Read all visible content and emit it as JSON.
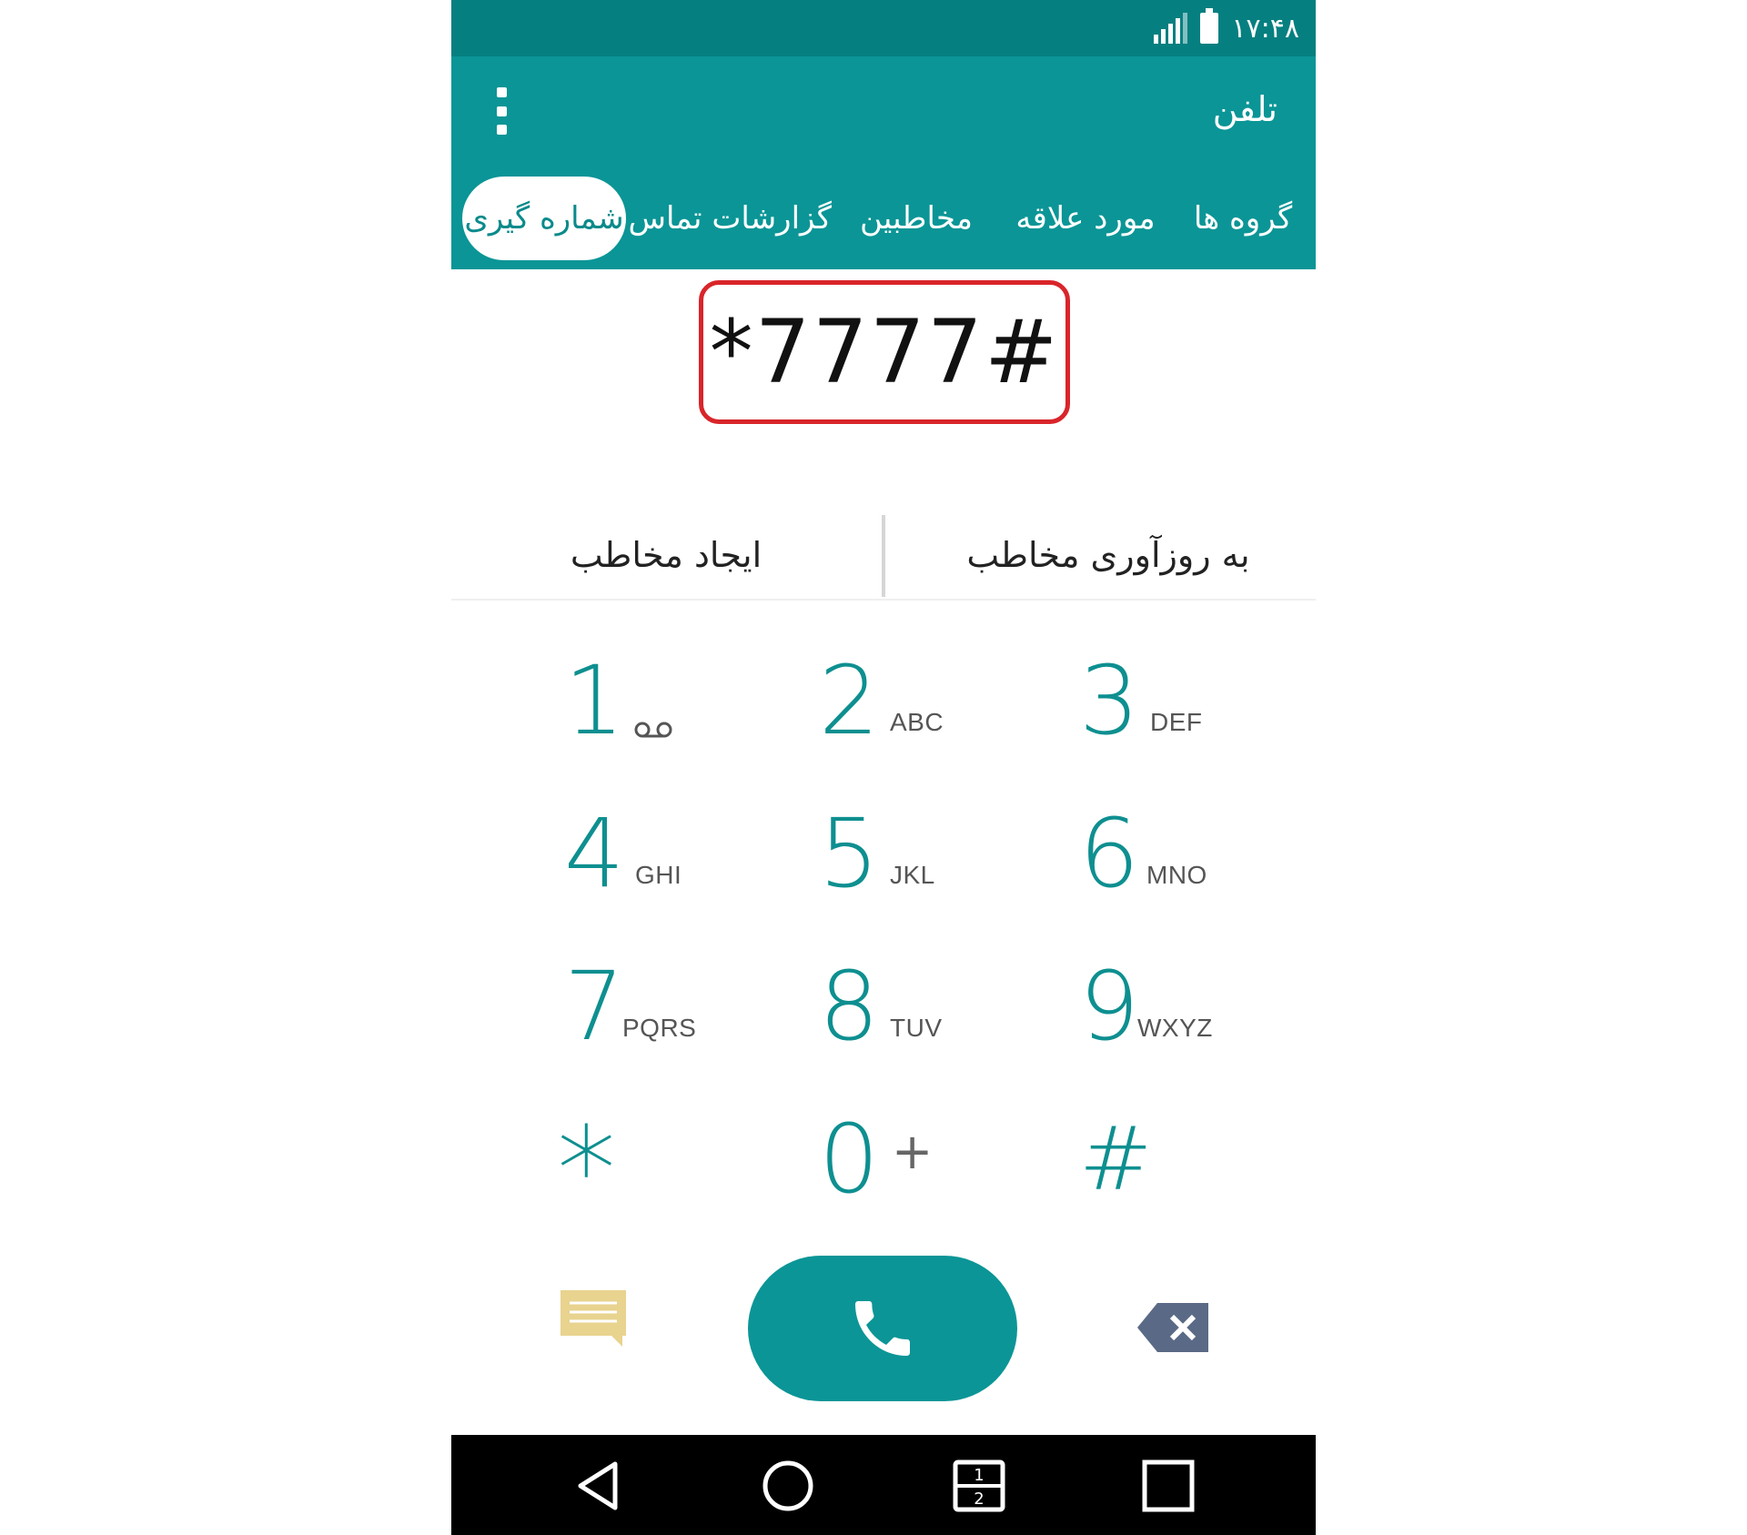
{
  "status_bar": {
    "time": "۱۷:۴۸",
    "icons": [
      "signal-icon",
      "battery-icon"
    ]
  },
  "app_bar": {
    "title": "تلفن",
    "menu_icon": "more-vertical-icon"
  },
  "tabs": [
    {
      "label": "گروه ها"
    },
    {
      "label": "مورد علاقه"
    },
    {
      "label": "مخاطبین"
    },
    {
      "label": "گزارشات تماس"
    },
    {
      "label": "شماره گیری",
      "active": true
    }
  ],
  "dialer": {
    "number": "*7777#",
    "highlight_color": "#d9252a"
  },
  "actions": {
    "update_contact": "به روزآوری مخاطب",
    "create_contact": "ایجاد مخاطب"
  },
  "keypad": [
    {
      "digit": "1",
      "letters": "",
      "icon": "voicemail-icon"
    },
    {
      "digit": "2",
      "letters": "ABC"
    },
    {
      "digit": "3",
      "letters": "DEF"
    },
    {
      "digit": "4",
      "letters": "GHI"
    },
    {
      "digit": "5",
      "letters": "JKL"
    },
    {
      "digit": "6",
      "letters": "MNO"
    },
    {
      "digit": "7",
      "letters": "PQRS"
    },
    {
      "digit": "8",
      "letters": "TUV"
    },
    {
      "digit": "9",
      "letters": "WXYZ"
    },
    {
      "digit": "*",
      "letters": ""
    },
    {
      "digit": "0",
      "letters": "+"
    },
    {
      "digit": "#",
      "letters": ""
    }
  ],
  "bottom_controls": {
    "message_icon": "message-icon",
    "call_icon": "phone-icon",
    "backspace_icon": "backspace-icon"
  },
  "nav_bar": {
    "items": [
      "back-icon",
      "home-icon",
      "dual-window-icon",
      "recents-icon"
    ]
  },
  "colors": {
    "accent": "#0b9596",
    "status_bar": "#067f80",
    "digit": "#0e8f90",
    "message_icon": "#e8d38f",
    "backspace_icon": "#5a6a86"
  }
}
